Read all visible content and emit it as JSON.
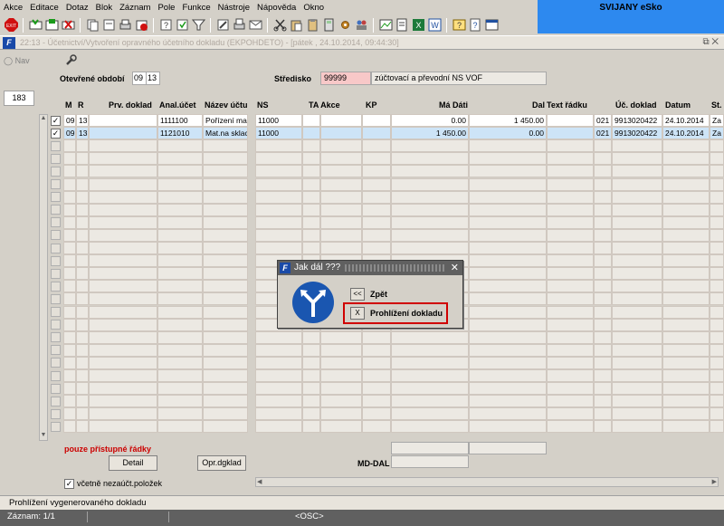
{
  "menu": [
    "Akce",
    "Editace",
    "Dotaz",
    "Blok",
    "Záznam",
    "Pole",
    "Funkce",
    "Nástroje",
    "Nápověda",
    "Okno"
  ],
  "brand": "SVIJANY eSko",
  "window_title": "22:13 - Účetnictví/Vytvoření opravného účetního dokladu (EKPOHDETO) - [pátek , 24.10.2014, 09:44:30]",
  "nav": {
    "label": "Nav",
    "count": "183"
  },
  "form": {
    "period_label": "Otevřené období",
    "period_month": "09",
    "period_year": "13",
    "center_label": "Středisko",
    "center_code": "99999",
    "center_name": "zúčtovací a převodní NS VOF"
  },
  "columns": {
    "m": "M",
    "r": "R",
    "prv": "Prv. doklad",
    "anal": "Anal.účet",
    "nazev": "Název účtu",
    "ns": "NS",
    "ta": "TA Akce",
    "kp": "KP",
    "md": "Má Dáti",
    "dal": "Dal",
    "text": "Text řádku",
    "uc": "Úč. doklad",
    "datum": "Datum",
    "st": "St."
  },
  "rows": [
    {
      "m": "09",
      "r": "13",
      "prv": "",
      "anal": "1111100",
      "nazev": "Pořízení mat",
      "ns": "11000",
      "ta": "",
      "kp": "",
      "md": "0.00",
      "dal": "1 450.00",
      "text": "",
      "kod": "021",
      "uc": "9913020422",
      "datum": "24.10.2014",
      "st": "Za"
    },
    {
      "m": "09",
      "r": "13",
      "prv": "",
      "anal": "1121010",
      "nazev": "Mat.na sklac",
      "ns": "11000",
      "ta": "",
      "kp": "",
      "md": "1 450.00",
      "dal": "0.00",
      "text": "",
      "kod": "021",
      "uc": "9913020422",
      "datum": "24.10.2014",
      "st": "Za"
    }
  ],
  "footer": {
    "only_accessible": "pouze přístupné řádky",
    "detail_button": "Detail",
    "opr_button": "Opr.dgklad",
    "md_dal_label": "MD-DAL",
    "include_label": "včetně nezaúčt.položek"
  },
  "dialog": {
    "title": "Jak dál ???",
    "back_key": "<<",
    "back_label": "Zpět",
    "view_key": "X",
    "view_label": "Prohlížení dokladu"
  },
  "status": {
    "message": "Prohlížení vygenerovaného dokladu",
    "record": "Záznam: 1/1",
    "mode": "<OSC>"
  },
  "colors": {
    "accent": "#2d89ef",
    "selected_row": "#cde4f7",
    "warning_text": "#cc0000",
    "highlight_border": "#d00000",
    "center_field": "#f8c8c8"
  }
}
